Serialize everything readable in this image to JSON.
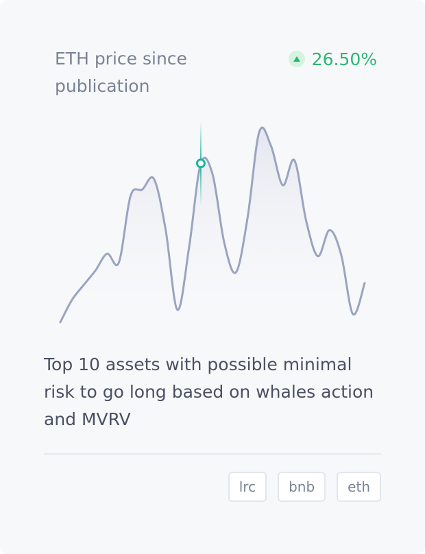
{
  "card": {
    "title": "ETH price since publication",
    "change": {
      "direction": "up",
      "value": "26.50%",
      "color": "#2bb673"
    },
    "description": "Top 10 assets with possible minimal risk to go long based on whales action and MVRV",
    "tags": [
      "lrc",
      "bnb",
      "eth"
    ]
  },
  "chart_data": {
    "type": "line",
    "series": [
      {
        "values": [
          2,
          38,
          62,
          85,
          112,
          98,
          205,
          215,
          232,
          150,
          22,
          122,
          257,
          240,
          130,
          82,
          170,
          308,
          285,
          222,
          262,
          165,
          108,
          150,
          110,
          15,
          65
        ]
      }
    ],
    "highlight_index": 12,
    "colors": {
      "line": "#9aa4c0",
      "area": "#e4e7ef",
      "marker": "#18b89a"
    }
  }
}
